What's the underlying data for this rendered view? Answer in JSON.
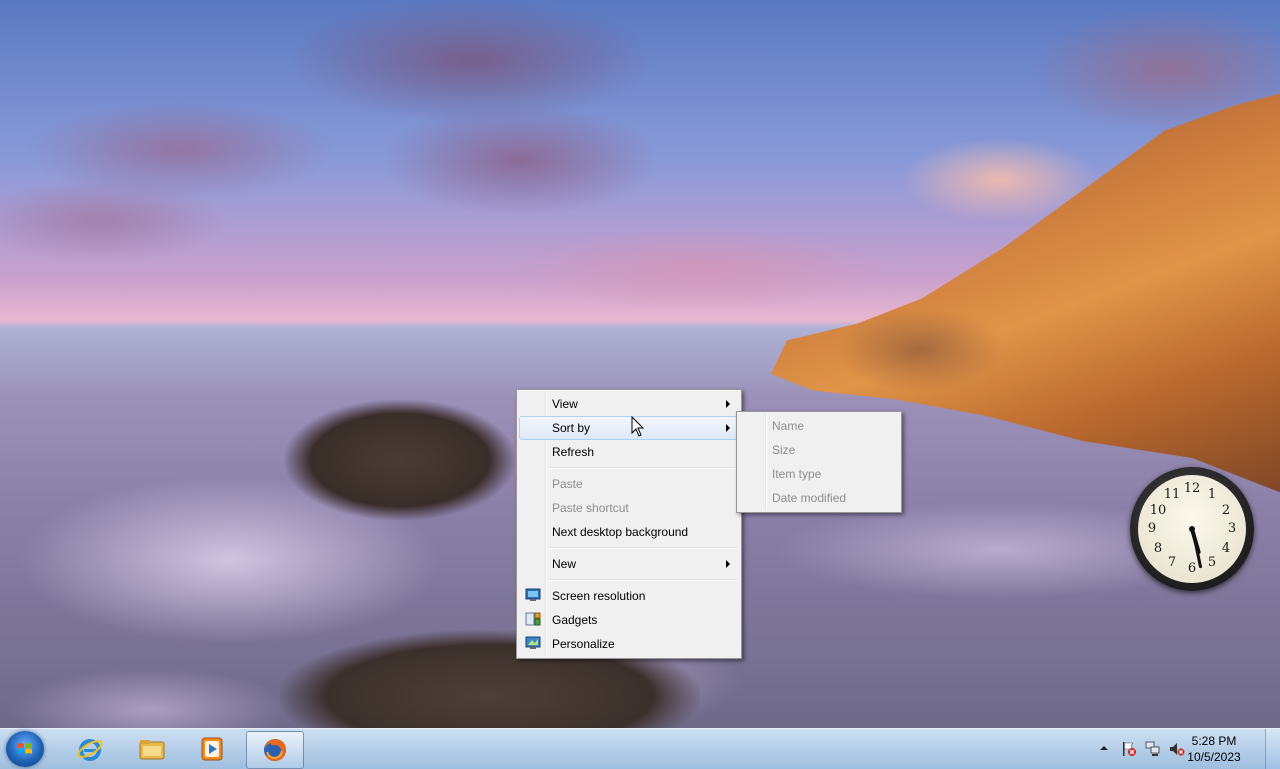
{
  "context_menu": {
    "items": [
      {
        "label": "View",
        "has_submenu": true
      },
      {
        "label": "Sort by",
        "has_submenu": true,
        "highlighted": true
      },
      {
        "label": "Refresh"
      },
      {
        "label": "Paste",
        "disabled": true
      },
      {
        "label": "Paste shortcut",
        "disabled": true
      },
      {
        "label": "Next desktop background"
      },
      {
        "label": "New",
        "has_submenu": true
      },
      {
        "label": "Screen resolution",
        "icon": "screen-resolution-icon"
      },
      {
        "label": "Gadgets",
        "icon": "gadgets-icon"
      },
      {
        "label": "Personalize",
        "icon": "personalize-icon"
      }
    ]
  },
  "sort_submenu": {
    "items": [
      {
        "label": "Name",
        "disabled": true
      },
      {
        "label": "Size",
        "disabled": true
      },
      {
        "label": "Item type",
        "disabled": true
      },
      {
        "label": "Date modified",
        "disabled": true
      }
    ]
  },
  "clock_gadget": {
    "numbers": [
      "12",
      "1",
      "2",
      "3",
      "4",
      "5",
      "6",
      "7",
      "8",
      "9",
      "10",
      "11"
    ]
  },
  "taskbar": {
    "pinned": [
      {
        "name": "internet-explorer-icon",
        "active": false
      },
      {
        "name": "file-explorer-icon",
        "active": false
      },
      {
        "name": "media-player-icon",
        "active": false
      },
      {
        "name": "firefox-icon",
        "active": true
      }
    ],
    "tray": {
      "time": "5:28 PM",
      "date": "10/5/2023"
    }
  },
  "colors": {
    "menu_bg": "#f0f0f0",
    "menu_highlight": "#dde8f7",
    "disabled_text": "#8d8d8d",
    "taskbar": "#a9c6e4"
  }
}
